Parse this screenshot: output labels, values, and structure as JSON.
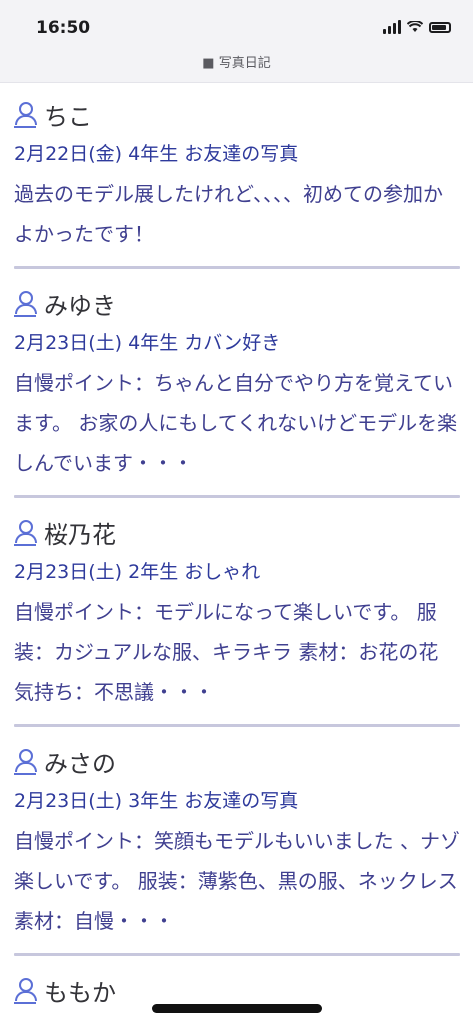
{
  "status_bar": {
    "time": "16:50",
    "url": "■ 写真日記"
  },
  "posts": [
    {
      "username": "ちこ",
      "meta": "2月22日(金) 4年生 お友達の写真",
      "body": "過去のモデル展したけれど、、、、初めての参加かよかったです！"
    },
    {
      "username": "みゆき",
      "meta": "2月23日(土) 4年生 カバン好き",
      "body": "自慢ポイント：ちゃんと自分でやり方を覚えています。 お家の人にもしてくれないけどモデルを楽しんでいます・・・"
    },
    {
      "username": "桜乃花",
      "meta": "2月23日(土) 2年生 おしゃれ",
      "body": "自慢ポイント：モデルになって楽しいです。 服装：カジュアルな服、キラキラ 素材：お花の花 気持ち：不思議・・・"
    },
    {
      "username": "みさの",
      "meta": "2月23日(土) 3年生 お友達の写真",
      "body": "自慢ポイント：笑顔もモデルもいいました 、ナゾ楽しいです。 服装：薄紫色、黒の服、ネックレス 素材：自慢・・・"
    },
    {
      "username": "ももか",
      "meta": "",
      "body": ""
    }
  ]
}
